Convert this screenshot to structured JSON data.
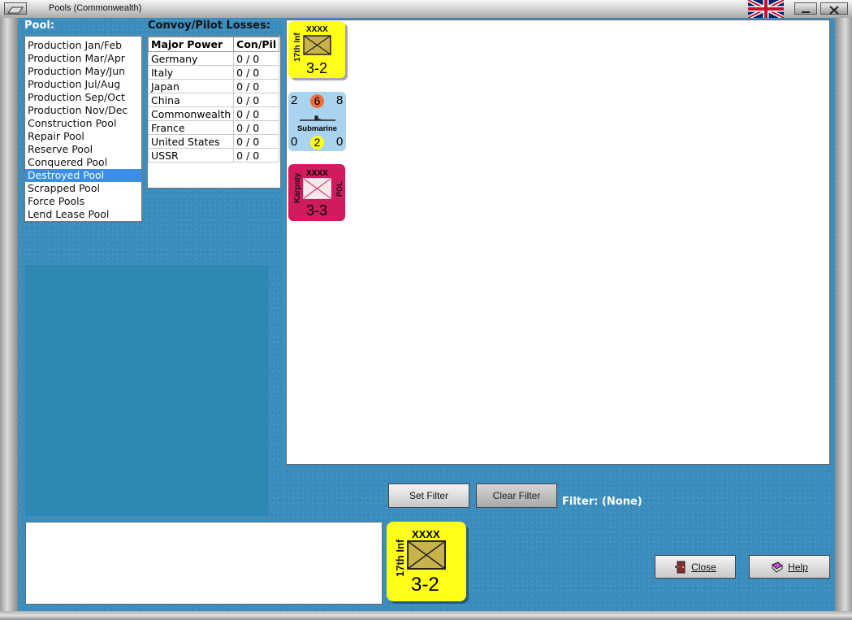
{
  "window": {
    "title": "Pools (Commonwealth)",
    "flag_icon": "union-jack-flag-icon"
  },
  "pool": {
    "heading": "Pool:",
    "items": [
      "Production Jan/Feb",
      "Production Mar/Apr",
      "Production May/Jun",
      "Production Jul/Aug",
      "Production Sep/Oct",
      "Production Nov/Dec",
      "Construction Pool",
      "Repair Pool",
      "Reserve Pool",
      "Conquered Pool",
      "Destroyed Pool",
      "Scrapped Pool",
      "Force Pools",
      "Lend Lease Pool"
    ],
    "selected": "Destroyed Pool"
  },
  "losses": {
    "heading": "Convoy/Pilot Losses:",
    "columns": [
      "Major Power",
      "Con/Pil"
    ],
    "rows": [
      [
        "Germany",
        "0 / 0"
      ],
      [
        "Italy",
        "0 / 0"
      ],
      [
        "Japan",
        "0 / 0"
      ],
      [
        "China",
        "0 / 0"
      ],
      [
        "Commonwealth",
        "0 / 0"
      ],
      [
        "France",
        "0 / 0"
      ],
      [
        "United States",
        "0 / 0"
      ],
      [
        "USSR",
        "0 / 0"
      ]
    ]
  },
  "units": [
    {
      "kind": "army",
      "name": "17th Inf",
      "size": "XXXX",
      "strength": "3-2",
      "color": "#ffff1a"
    },
    {
      "kind": "naval",
      "name": "Submarine",
      "top_left": "2",
      "top_mid": "6",
      "top_right": "8",
      "bot_left": "0",
      "bot_mid": "2",
      "bot_right": "0",
      "color": "#a9d3ee"
    },
    {
      "kind": "army",
      "name": "Karpaty",
      "size": "XXXX",
      "strength": "3-3",
      "tag": "POL",
      "color": "#d01b5e"
    }
  ],
  "selected_unit": {
    "name": "17th Inf",
    "size": "XXXX",
    "strength": "3-2",
    "color": "#ffff1a"
  },
  "filter": {
    "set_label": "Set Filter",
    "clear_label": "Clear Filter",
    "status": "Filter:  (None)"
  },
  "buttons": {
    "close_label": "Close",
    "help_label": "Help",
    "close_icon": "door-exit-icon",
    "help_icon": "book-help-icon"
  }
}
